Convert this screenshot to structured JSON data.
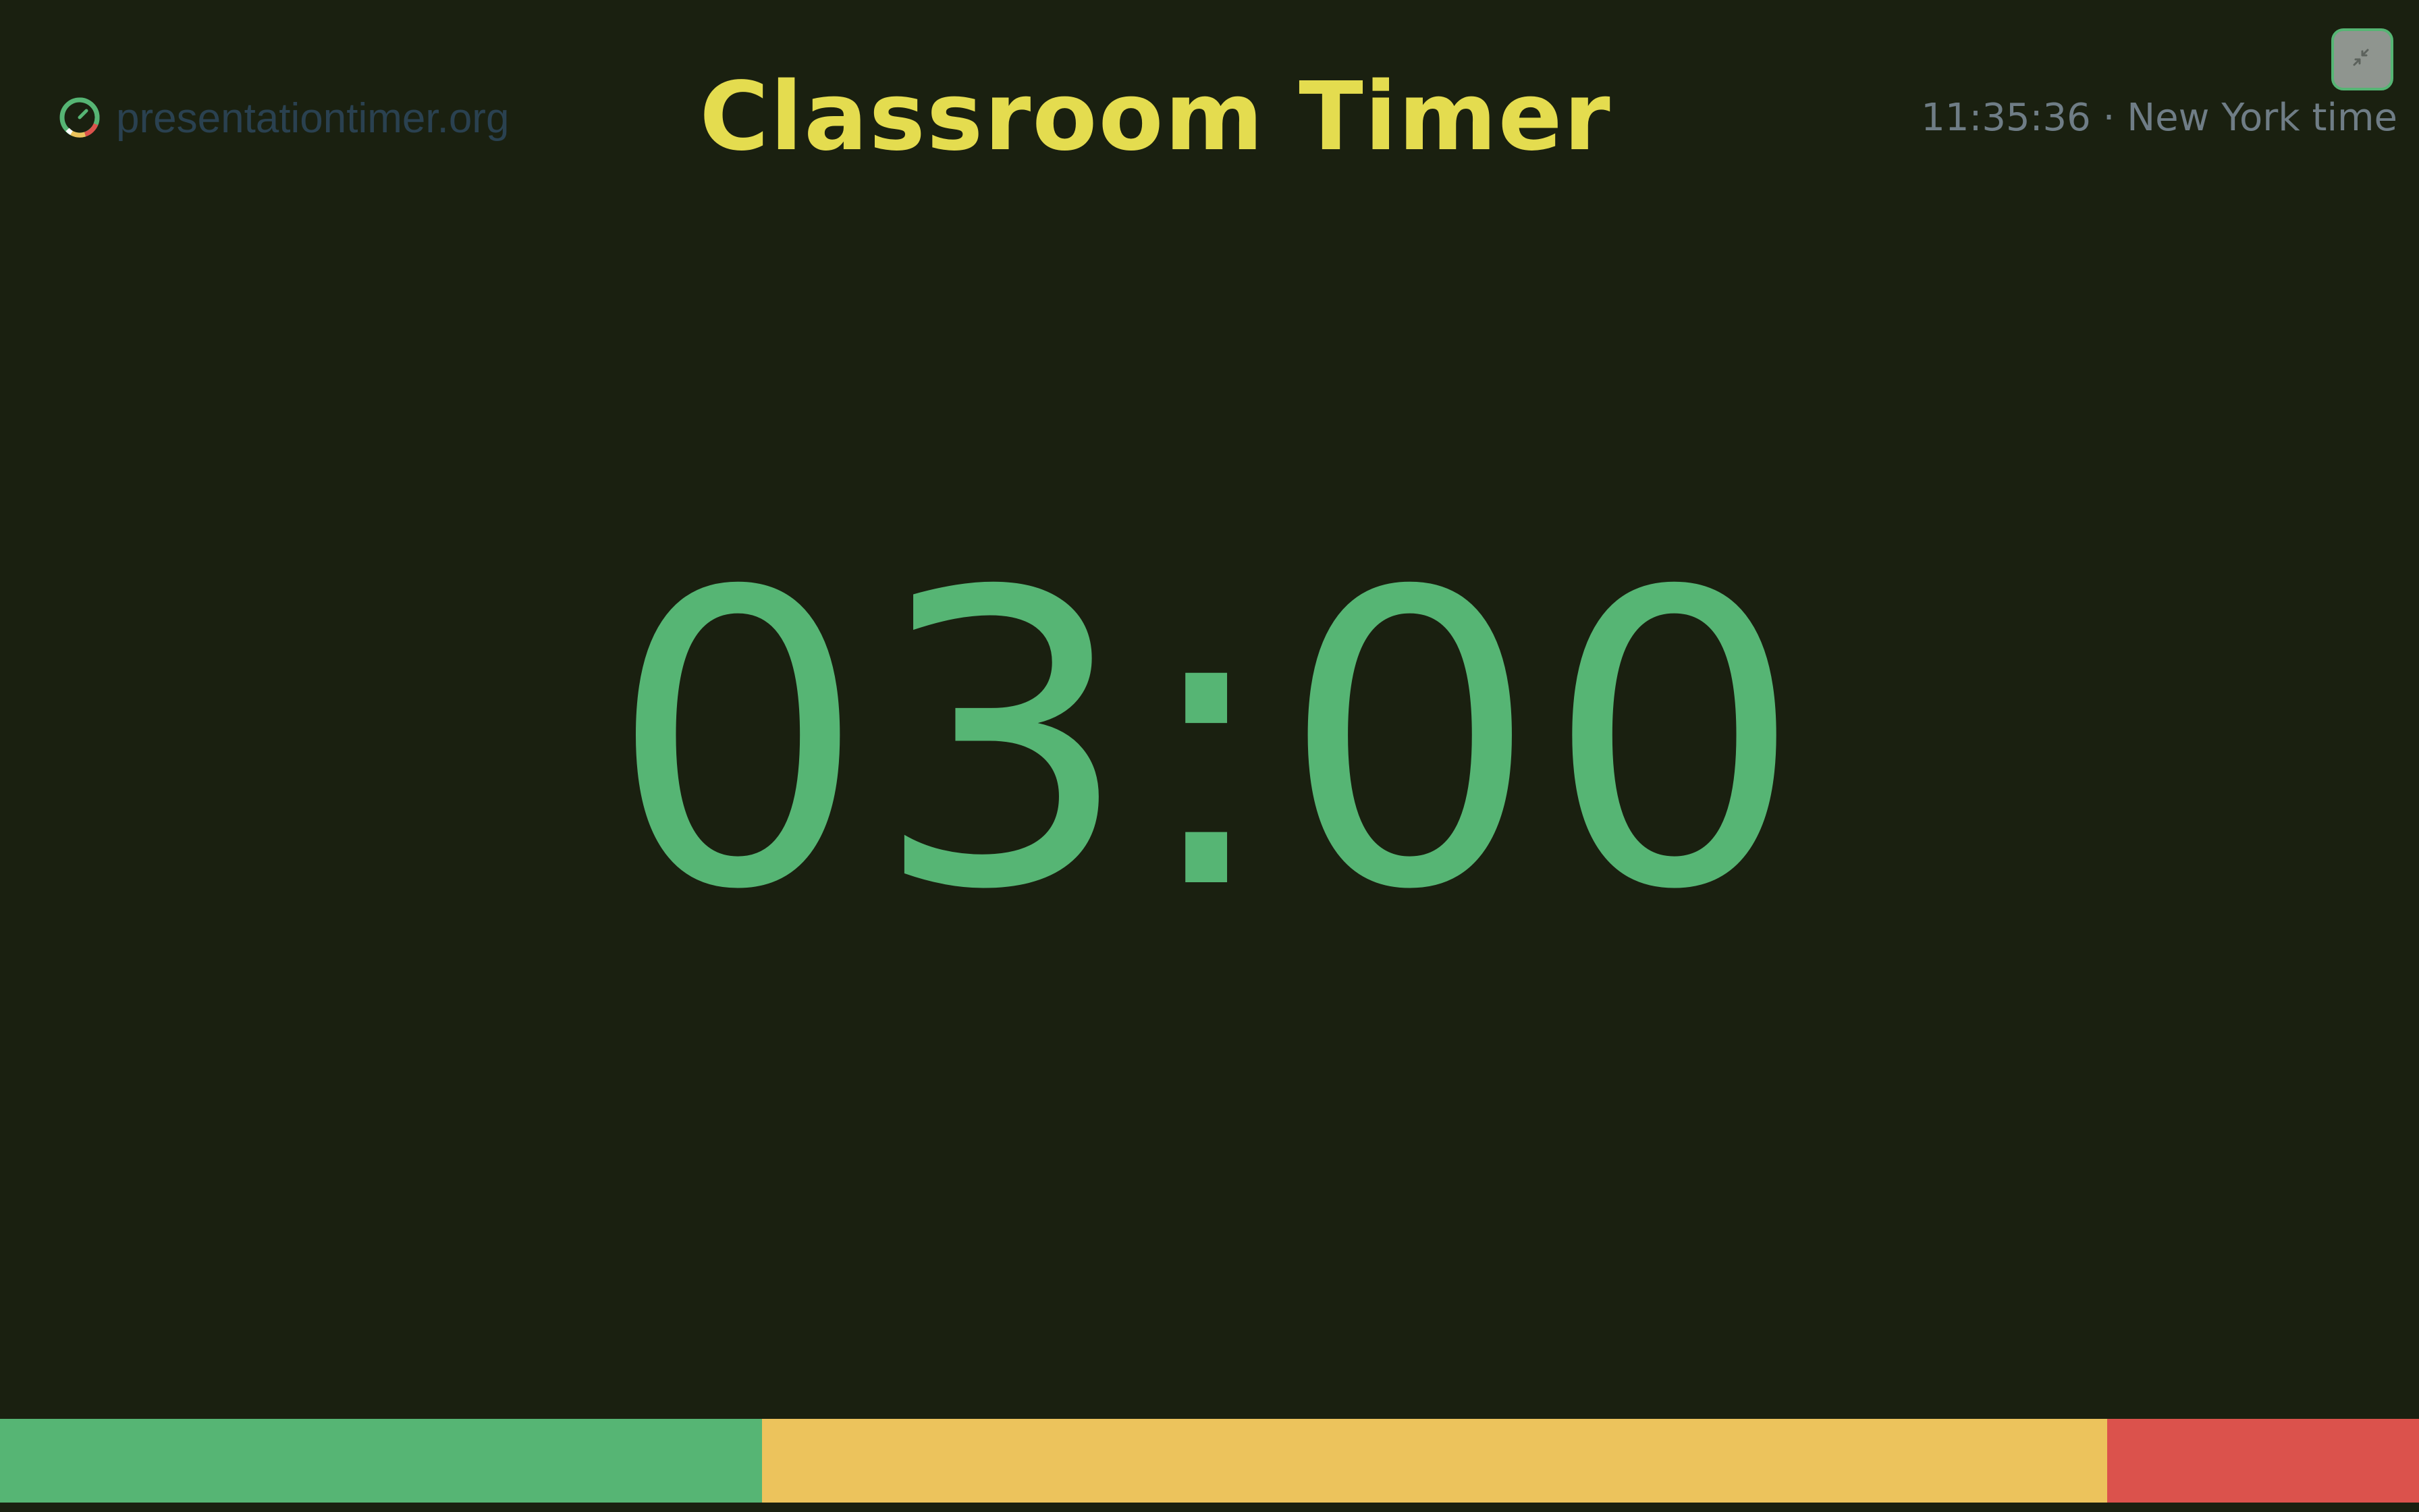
{
  "brand": {
    "name": "presentationtimer.org",
    "icon": "timer-logo-icon"
  },
  "header": {
    "title": "Classroom Timer",
    "clock_time": "11:35:36",
    "clock_separator": "·",
    "clock_zone": "New York time",
    "exit_fullscreen_icon": "collapse-arrows-icon"
  },
  "timer": {
    "display": "03:00"
  },
  "phases": [
    {
      "name": "green",
      "color": "#56b574",
      "fraction": 0.315
    },
    {
      "name": "yellow",
      "color": "#ecc35c",
      "fraction": 0.556
    },
    {
      "name": "red",
      "color": "#db524c",
      "fraction": 0.129
    }
  ],
  "colors": {
    "background": "#1a2010",
    "title": "#e4dc4f",
    "timer": "#56b574",
    "clock": "#6f7d86",
    "brand": "#2a4150"
  }
}
